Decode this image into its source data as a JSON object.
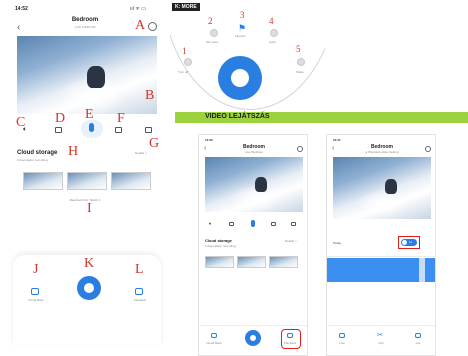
{
  "left_phone": {
    "status_time": "14:52",
    "status_icons": "ııl ᯤ ▭",
    "title": "Bedroom",
    "subtitle": "LIVE WEBCAM",
    "cloud_title": "Cloud storage",
    "cloud_sub": "3 days alarm recording",
    "details": "Details >",
    "more_text": "Reached limit. Watch it",
    "label_A": "A",
    "label_B": "B",
    "label_C": "C",
    "label_D": "D",
    "label_E": "E",
    "label_F": "F",
    "label_G": "G",
    "label_H": "H",
    "label_I": "I",
    "label_J": "J",
    "label_K": "K",
    "label_L": "L",
    "tab_left": "Cloud Back",
    "tab_right": "Playback"
  },
  "more_panel": {
    "badge": "K: MORE",
    "items": [
      {
        "num": "1",
        "label": "Turn off"
      },
      {
        "num": "2",
        "label": "HD video"
      },
      {
        "num": "3",
        "label": "Flowers"
      },
      {
        "num": "4",
        "label": "Light"
      },
      {
        "num": "5",
        "label": "Share"
      }
    ]
  },
  "banner": {
    "text": "VIDEO LEJÁTSZÁS"
  },
  "mid_phone": {
    "status_time": "14:52",
    "title": "Bedroom",
    "subtitle": "Live Webcam",
    "cloud_title": "Cloud storage",
    "cloud_sub": "3 days alarm recording",
    "details": "Details >",
    "tab_left": "Cloud Back",
    "tab_right": "Playback"
  },
  "right_phone": {
    "status_time": "15:47",
    "title": "Bedroom",
    "subtitle": "● Playback video Setting",
    "date_label": "Today",
    "toggle_label": "1x",
    "tab_left": "Live",
    "tab_mid": "Clip",
    "tab_right": "List"
  }
}
